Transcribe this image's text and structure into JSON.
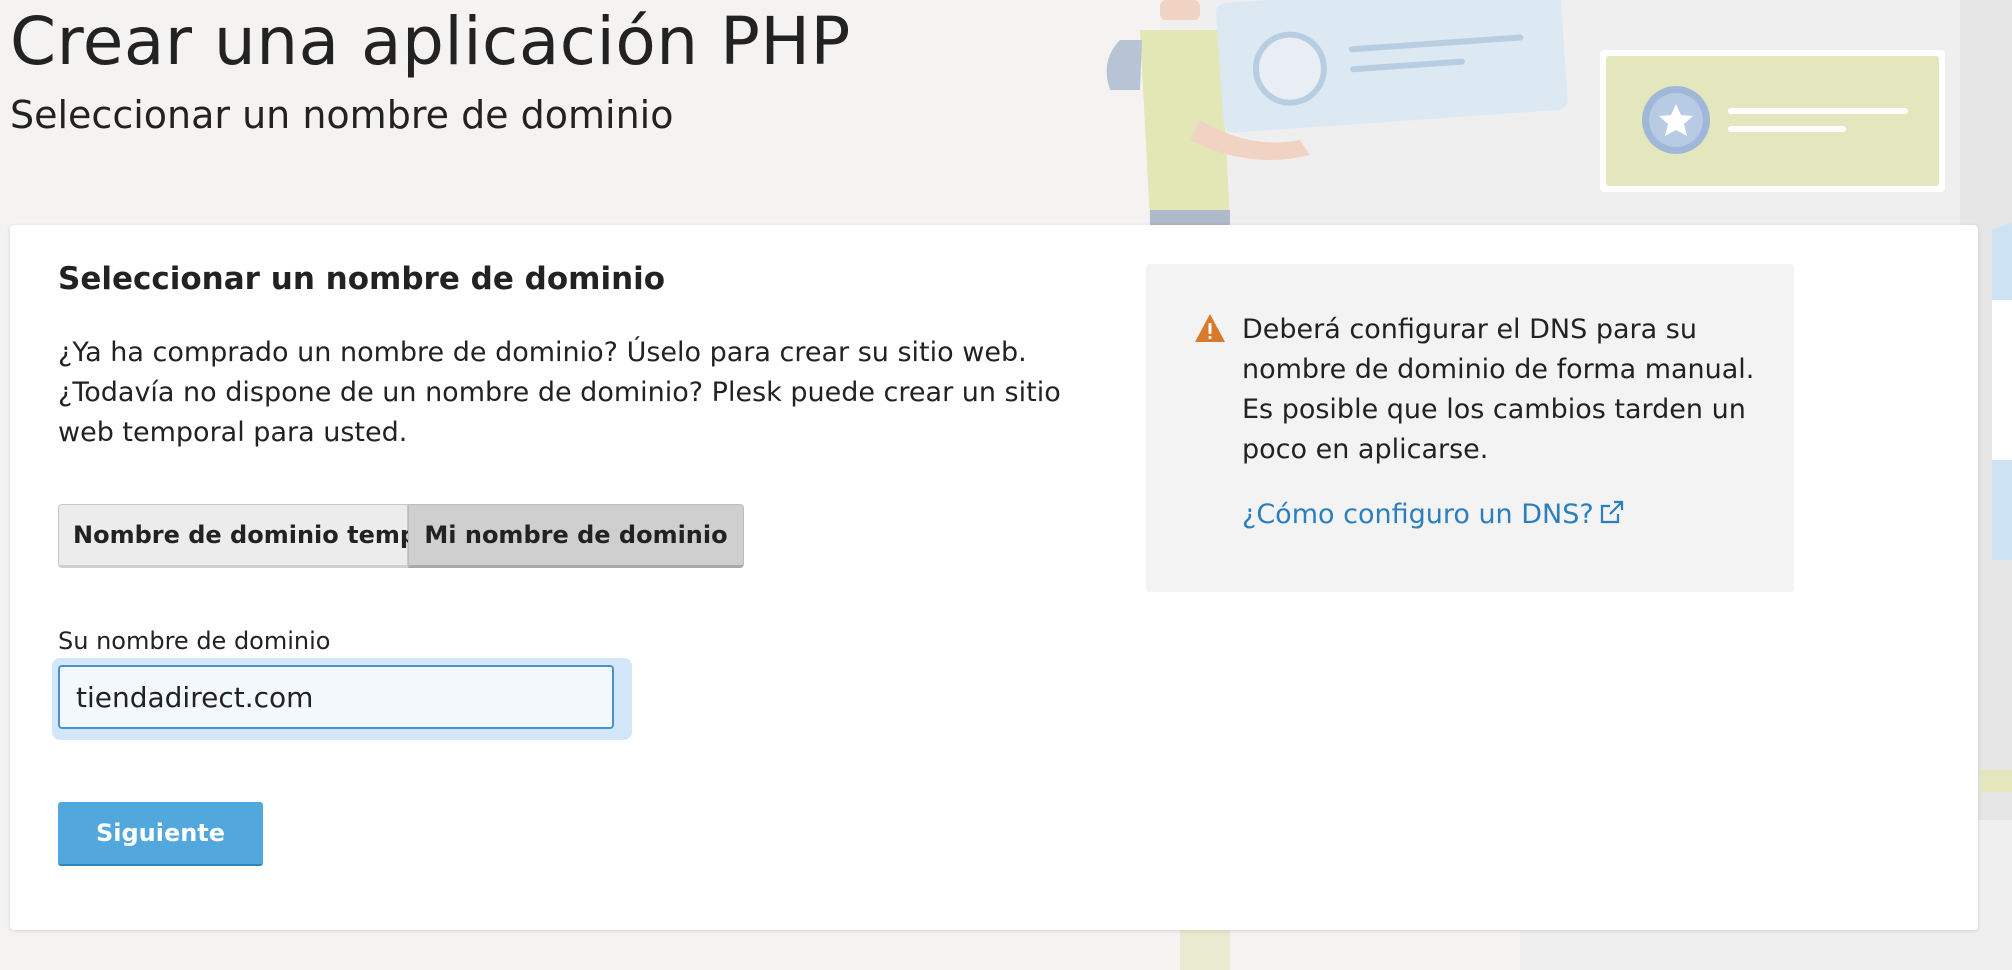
{
  "header": {
    "title": "Crear una aplicación PHP",
    "subtitle": "Seleccionar un nombre de dominio"
  },
  "card": {
    "title": "Seleccionar un nombre de dominio",
    "intro": "¿Ya ha comprado un nombre de dominio? Úselo para crear su sitio web. ¿Todavía no dispone de un nombre de dominio? Plesk puede crear un sitio web temporal para usted.",
    "segments": [
      {
        "label": "Nombre de dominio temporal",
        "selected": false
      },
      {
        "label": "Mi nombre de dominio",
        "selected": true
      }
    ],
    "field_label": "Su nombre de dominio",
    "domain_value": "tiendadirect.com",
    "next_label": "Siguiente"
  },
  "info": {
    "icon": "warning-icon",
    "text": "Deberá configurar el DNS para su nombre de dominio de forma manual. Es posible que los cambios tarden un poco en aplicarse.",
    "link_label": "¿Cómo configuro un DNS?",
    "link_icon": "external-link-icon"
  },
  "colors": {
    "accent": "#52a8dc",
    "link": "#2c7fbe",
    "warning": "#d9792b",
    "background": "#f4f3f2"
  }
}
